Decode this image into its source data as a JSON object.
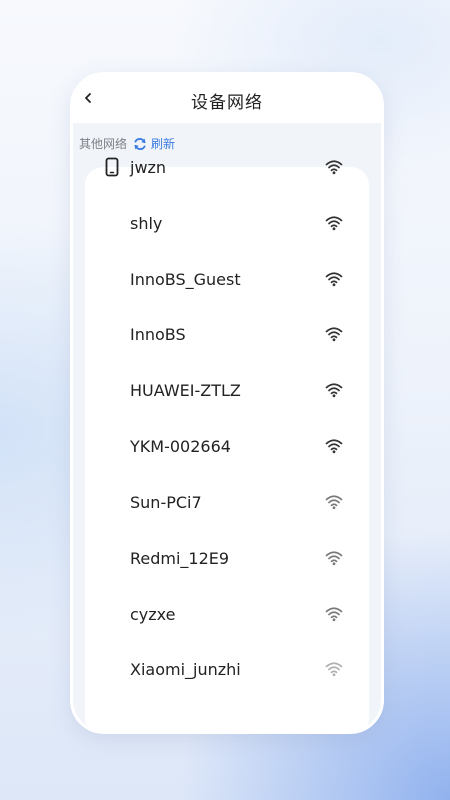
{
  "header": {
    "title": "设备网络"
  },
  "section": {
    "label": "其他网络",
    "refresh_label": "刷新"
  },
  "networks": [
    {
      "ssid": "jwzn",
      "connected_device": true,
      "signal": "strong"
    },
    {
      "ssid": "shly",
      "connected_device": false,
      "signal": "strong"
    },
    {
      "ssid": "InnoBS_Guest",
      "connected_device": false,
      "signal": "strong"
    },
    {
      "ssid": "InnoBS",
      "connected_device": false,
      "signal": "strong"
    },
    {
      "ssid": "HUAWEI-ZTLZ",
      "connected_device": false,
      "signal": "strong"
    },
    {
      "ssid": "YKM-002664",
      "connected_device": false,
      "signal": "strong"
    },
    {
      "ssid": "Sun-PCi7",
      "connected_device": false,
      "signal": "medium"
    },
    {
      "ssid": "Redmi_12E9",
      "connected_device": false,
      "signal": "medium"
    },
    {
      "ssid": "cyzxe",
      "connected_device": false,
      "signal": "medium"
    },
    {
      "ssid": "Xiaomi_junzhi",
      "connected_device": false,
      "signal": "weak"
    }
  ],
  "icons": {
    "back": "chevron-left-icon",
    "refresh": "refresh-icon",
    "device": "phone-icon",
    "signal": "wifi-icon"
  },
  "colors": {
    "accent": "#3a7be0",
    "text": "#222222",
    "muted": "#7b7f87",
    "wifi_strong": "#333333",
    "wifi_medium": "#7a7a7a",
    "wifi_weak": "#b0b0b0"
  }
}
